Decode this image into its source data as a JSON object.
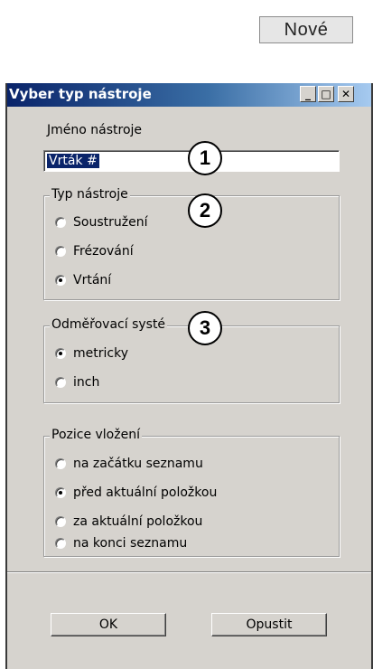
{
  "top_button": "Nové",
  "dialog": {
    "title": "Vyber typ nástroje",
    "window_buttons": {
      "minimize": "_",
      "maximize": "□",
      "close": "✕"
    },
    "name_label": "Jméno nástroje",
    "name_value": "Vrták #",
    "tool_type": {
      "legend": "Typ nástroje",
      "options": [
        "Soustružení",
        "Frézování",
        "Vrtání"
      ],
      "selected": "Vrtání"
    },
    "measure": {
      "legend": "Odměřovací systé",
      "options": [
        "metricky",
        "inch"
      ],
      "selected": "metricky"
    },
    "position": {
      "legend": "Pozice vložení",
      "options": [
        "na začátku seznamu",
        "před aktuální položkou",
        "za aktuální položkou",
        "na konci seznamu"
      ],
      "selected": "před aktuální položkou"
    },
    "ok_label": "OK",
    "cancel_label": "Opustit"
  },
  "callouts": [
    "1",
    "2",
    "3"
  ]
}
